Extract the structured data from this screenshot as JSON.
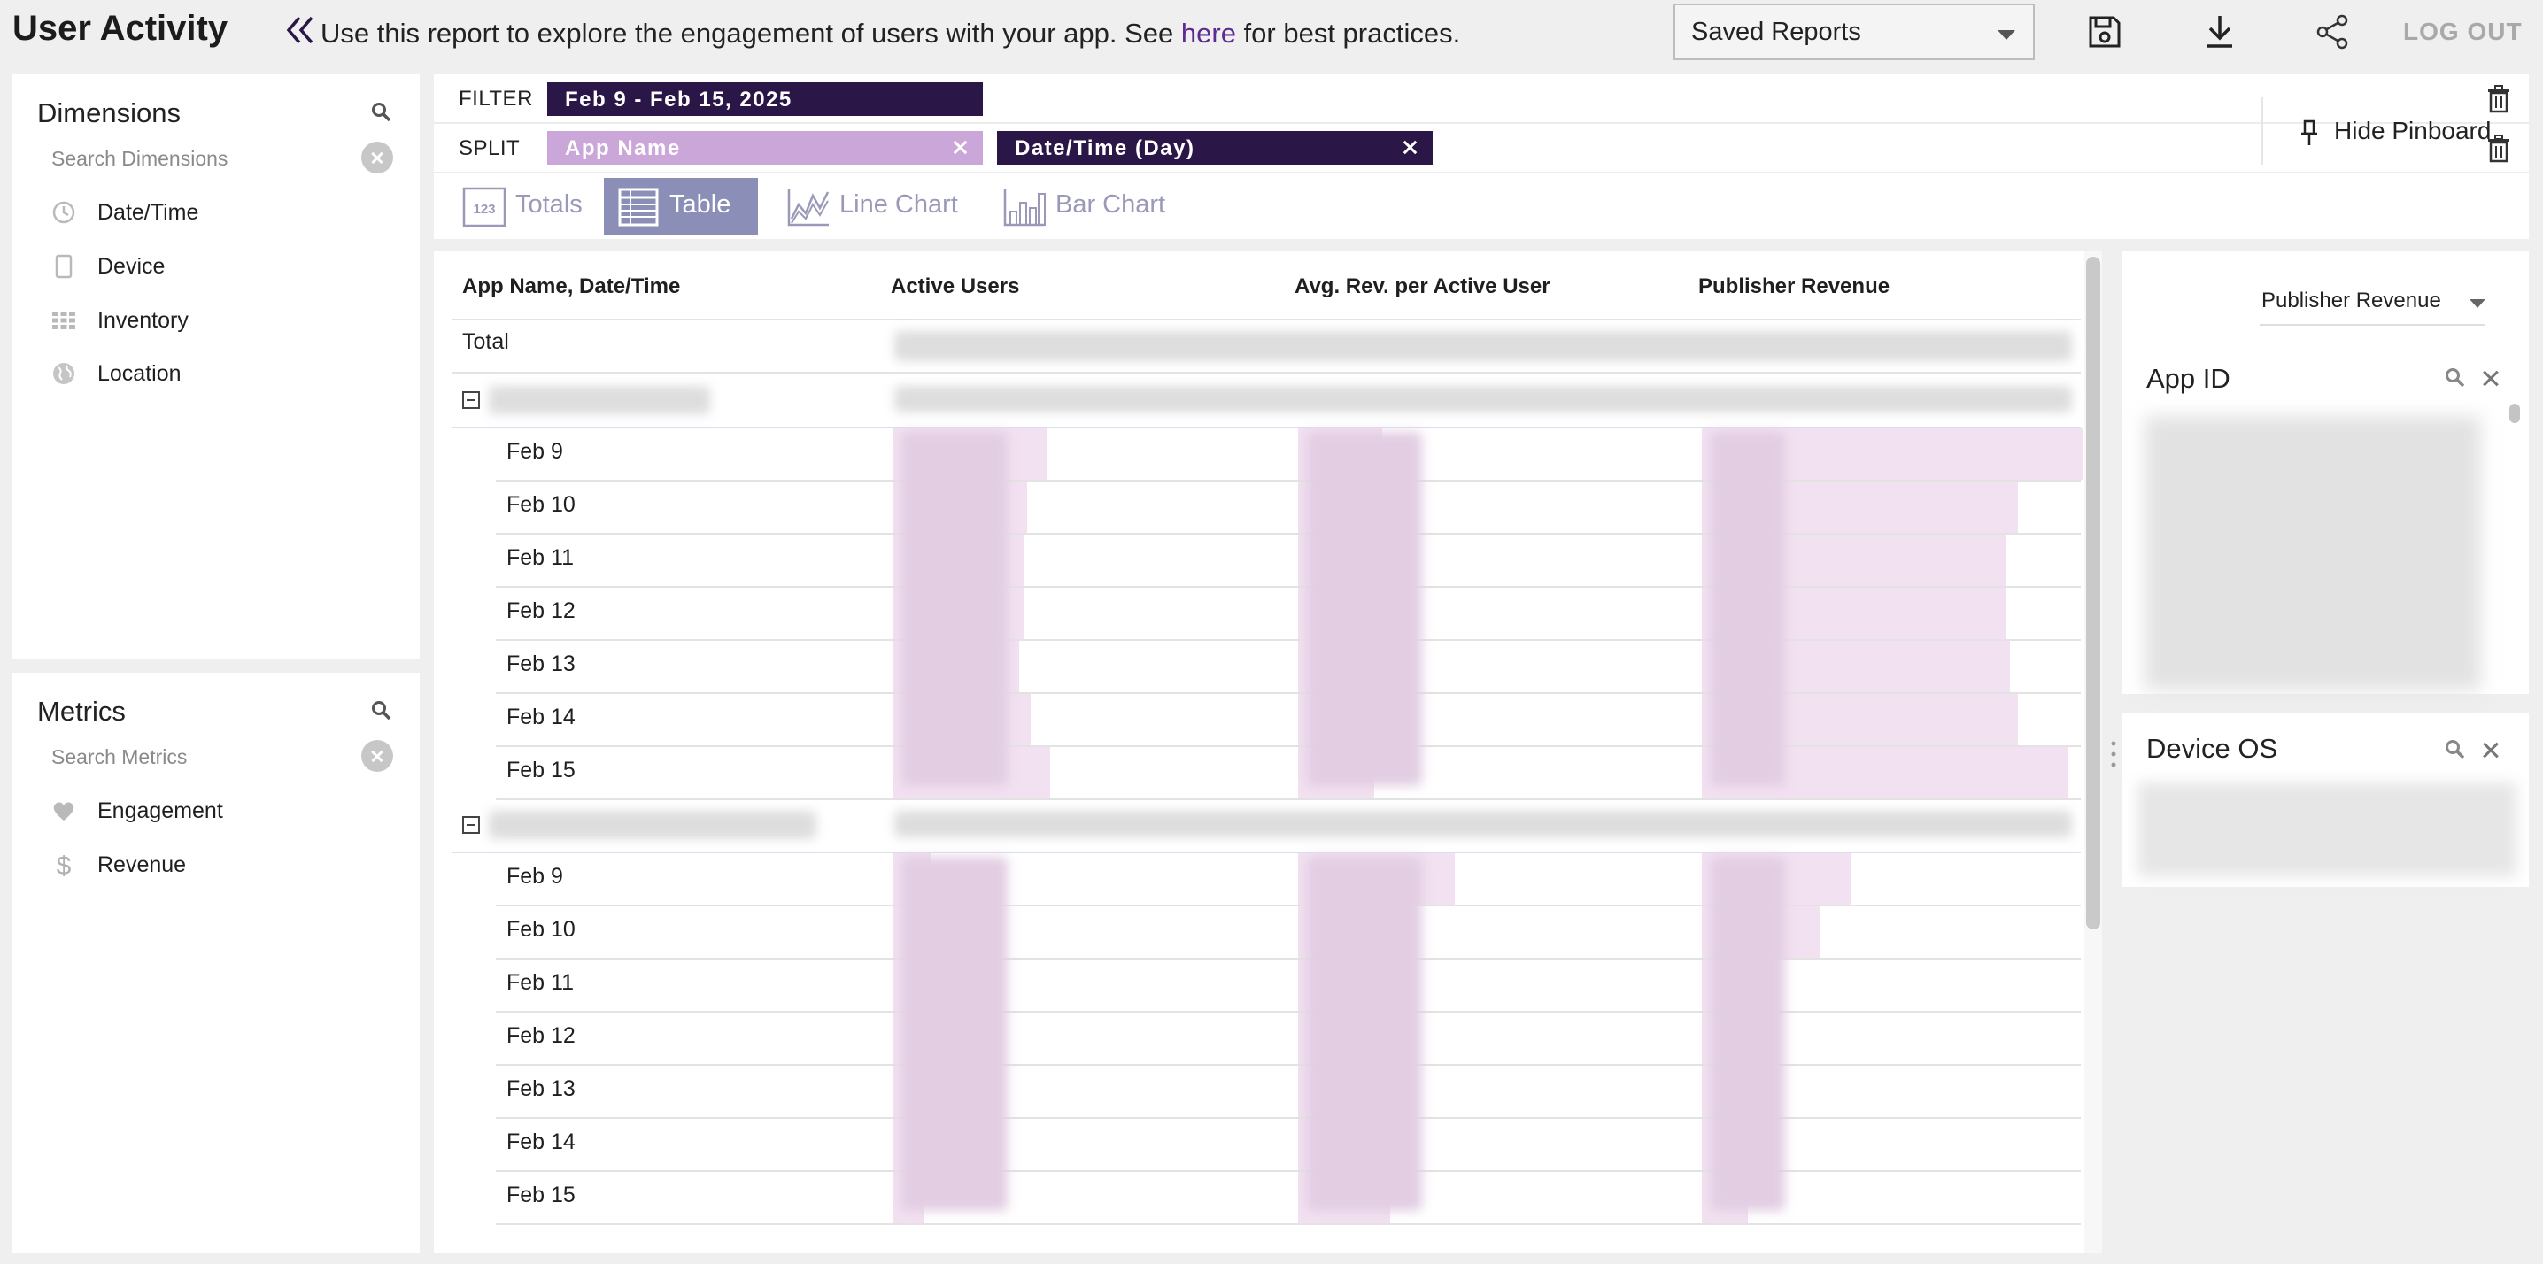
{
  "header": {
    "title": "User Activity",
    "notice_pre": "Use this report to explore the engagement of users with your app. See ",
    "notice_link": "here",
    "notice_post": " for best practices.",
    "saved_reports": "Saved Reports",
    "logout": "LOG OUT"
  },
  "dimensions": {
    "title": "Dimensions",
    "search_placeholder": "Search Dimensions",
    "items": [
      {
        "label": "Date/Time",
        "icon": "clock-icon"
      },
      {
        "label": "Device",
        "icon": "device-icon"
      },
      {
        "label": "Inventory",
        "icon": "grid-icon"
      },
      {
        "label": "Location",
        "icon": "globe-icon"
      }
    ]
  },
  "metrics": {
    "title": "Metrics",
    "search_placeholder": "Search Metrics",
    "items": [
      {
        "label": "Engagement",
        "icon": "heart-icon"
      },
      {
        "label": "Revenue",
        "icon": "dollar-icon"
      }
    ]
  },
  "filter": {
    "label": "FILTER",
    "pill": "Feb 9 - Feb 15, 2025"
  },
  "split": {
    "label": "SPLIT",
    "pills": [
      "App Name",
      "Date/Time (Day)"
    ]
  },
  "viz": {
    "totals": "Totals",
    "table": "Table",
    "line_chart": "Line Chart",
    "bar_chart": "Bar Chart",
    "hide_pinboard": "Hide Pinboard"
  },
  "table": {
    "columns": [
      "App Name, Date/Time",
      "Active Users",
      "Avg. Rev. per Active User",
      "Publisher Revenue"
    ],
    "total_label": "Total",
    "groups": [
      {
        "rows": [
          {
            "date": "Feb 9",
            "active_users": 0.4,
            "avg_rev": 0.22,
            "pub_rev": 1.0
          },
          {
            "date": "Feb 10",
            "active_users": 0.35,
            "avg_rev": 0.2,
            "pub_rev": 0.83
          },
          {
            "date": "Feb 11",
            "active_users": 0.34,
            "avg_rev": 0.19,
            "pub_rev": 0.8
          },
          {
            "date": "Feb 12",
            "active_users": 0.34,
            "avg_rev": 0.19,
            "pub_rev": 0.8
          },
          {
            "date": "Feb 13",
            "active_users": 0.33,
            "avg_rev": 0.2,
            "pub_rev": 0.81
          },
          {
            "date": "Feb 14",
            "active_users": 0.36,
            "avg_rev": 0.19,
            "pub_rev": 0.83
          },
          {
            "date": "Feb 15",
            "active_users": 0.41,
            "avg_rev": 0.2,
            "pub_rev": 0.96
          }
        ]
      },
      {
        "rows": [
          {
            "date": "Feb 9",
            "active_users": 0.1,
            "avg_rev": 0.41,
            "pub_rev": 0.39
          },
          {
            "date": "Feb 10",
            "active_users": 0.1,
            "avg_rev": 0.26,
            "pub_rev": 0.31
          },
          {
            "date": "Feb 11",
            "active_users": 0.1,
            "avg_rev": 0.22,
            "pub_rev": 0.1
          },
          {
            "date": "Feb 12",
            "active_users": 0.1,
            "avg_rev": 0.22,
            "pub_rev": 0.1
          },
          {
            "date": "Feb 13",
            "active_users": 0.1,
            "avg_rev": 0.2,
            "pub_rev": 0.1
          },
          {
            "date": "Feb 14",
            "active_users": 0.1,
            "avg_rev": 0.2,
            "pub_rev": 0.1
          },
          {
            "date": "Feb 15",
            "active_users": 0.08,
            "avg_rev": 0.24,
            "pub_rev": 0.12
          }
        ]
      }
    ]
  },
  "pinboard": {
    "sort_by": "Publisher Revenue",
    "cards": [
      "App ID",
      "Device OS"
    ]
  },
  "colors": {
    "accent_dark": "#2b1648",
    "accent_light": "#cba6d8",
    "bar": "#f2e1f1",
    "viz_active": "#8b8eb6"
  }
}
